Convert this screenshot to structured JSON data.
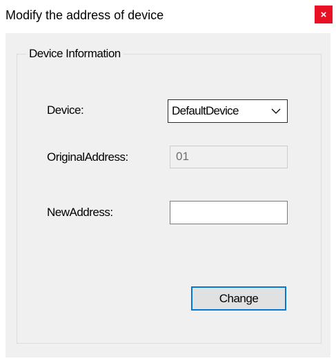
{
  "window": {
    "title": "Modify the address of device",
    "close_glyph": "×",
    "close_color": "#e81123"
  },
  "group": {
    "legend": "Device Information"
  },
  "form": {
    "device_label": "Device:",
    "device_value": "DefaultDevice",
    "original_address_label": "OriginalAddress:",
    "original_address_value": "01",
    "new_address_label": "NewAddress:",
    "new_address_value": "",
    "change_button_label": "Change"
  },
  "colors": {
    "client_background": "#f0f0f0",
    "focus_border": "#0078d7"
  }
}
